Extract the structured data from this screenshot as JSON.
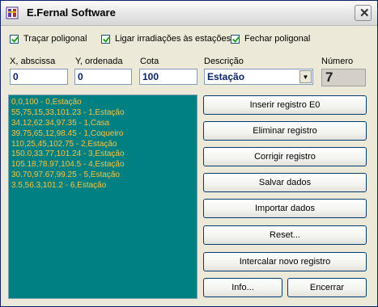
{
  "window": {
    "title": "E.Fernal Software"
  },
  "options": {
    "tracar_poligonal": "Traçar poligonal",
    "ligar_irradiacoes": "Ligar irradiações às estações",
    "fechar_poligonal": "Fechar poligonal"
  },
  "fields": {
    "x_label": "X, abscissa",
    "x_value": "0",
    "y_label": "Y, ordenada",
    "y_value": "0",
    "cota_label": "Cota",
    "cota_value": "100",
    "descricao_label": "Descrição",
    "descricao_value": "Estação",
    "numero_label": "Número",
    "numero_value": "7"
  },
  "records": [
    "0,0,100 - 0,Estação",
    "55,75,15,33,101.23 - 1,Estação",
    "34.12,62.34,97.35 - 1,Casa",
    "39.75,65,12,98.45 - 1,Coqueiro",
    "110,25,45,102.75 - 2,Estação",
    "150.0,33.77,101.24 - 3,Estação",
    "105.18,78.97,104.5 - 4,Estação",
    "30.70,97.67,99.25 - 5,Estação",
    "3.5,56.3,101.2 - 6,Estação"
  ],
  "buttons": {
    "inserir": "Inserir registro E0",
    "eliminar": "Eliminar registro",
    "corrigir": "Corrigir registro",
    "salvar": "Salvar dados",
    "importar": "Importar dados",
    "reset": "Reset...",
    "intercalar": "Intercalar novo registro",
    "info": "Info...",
    "encerrar": "Encerrar"
  }
}
